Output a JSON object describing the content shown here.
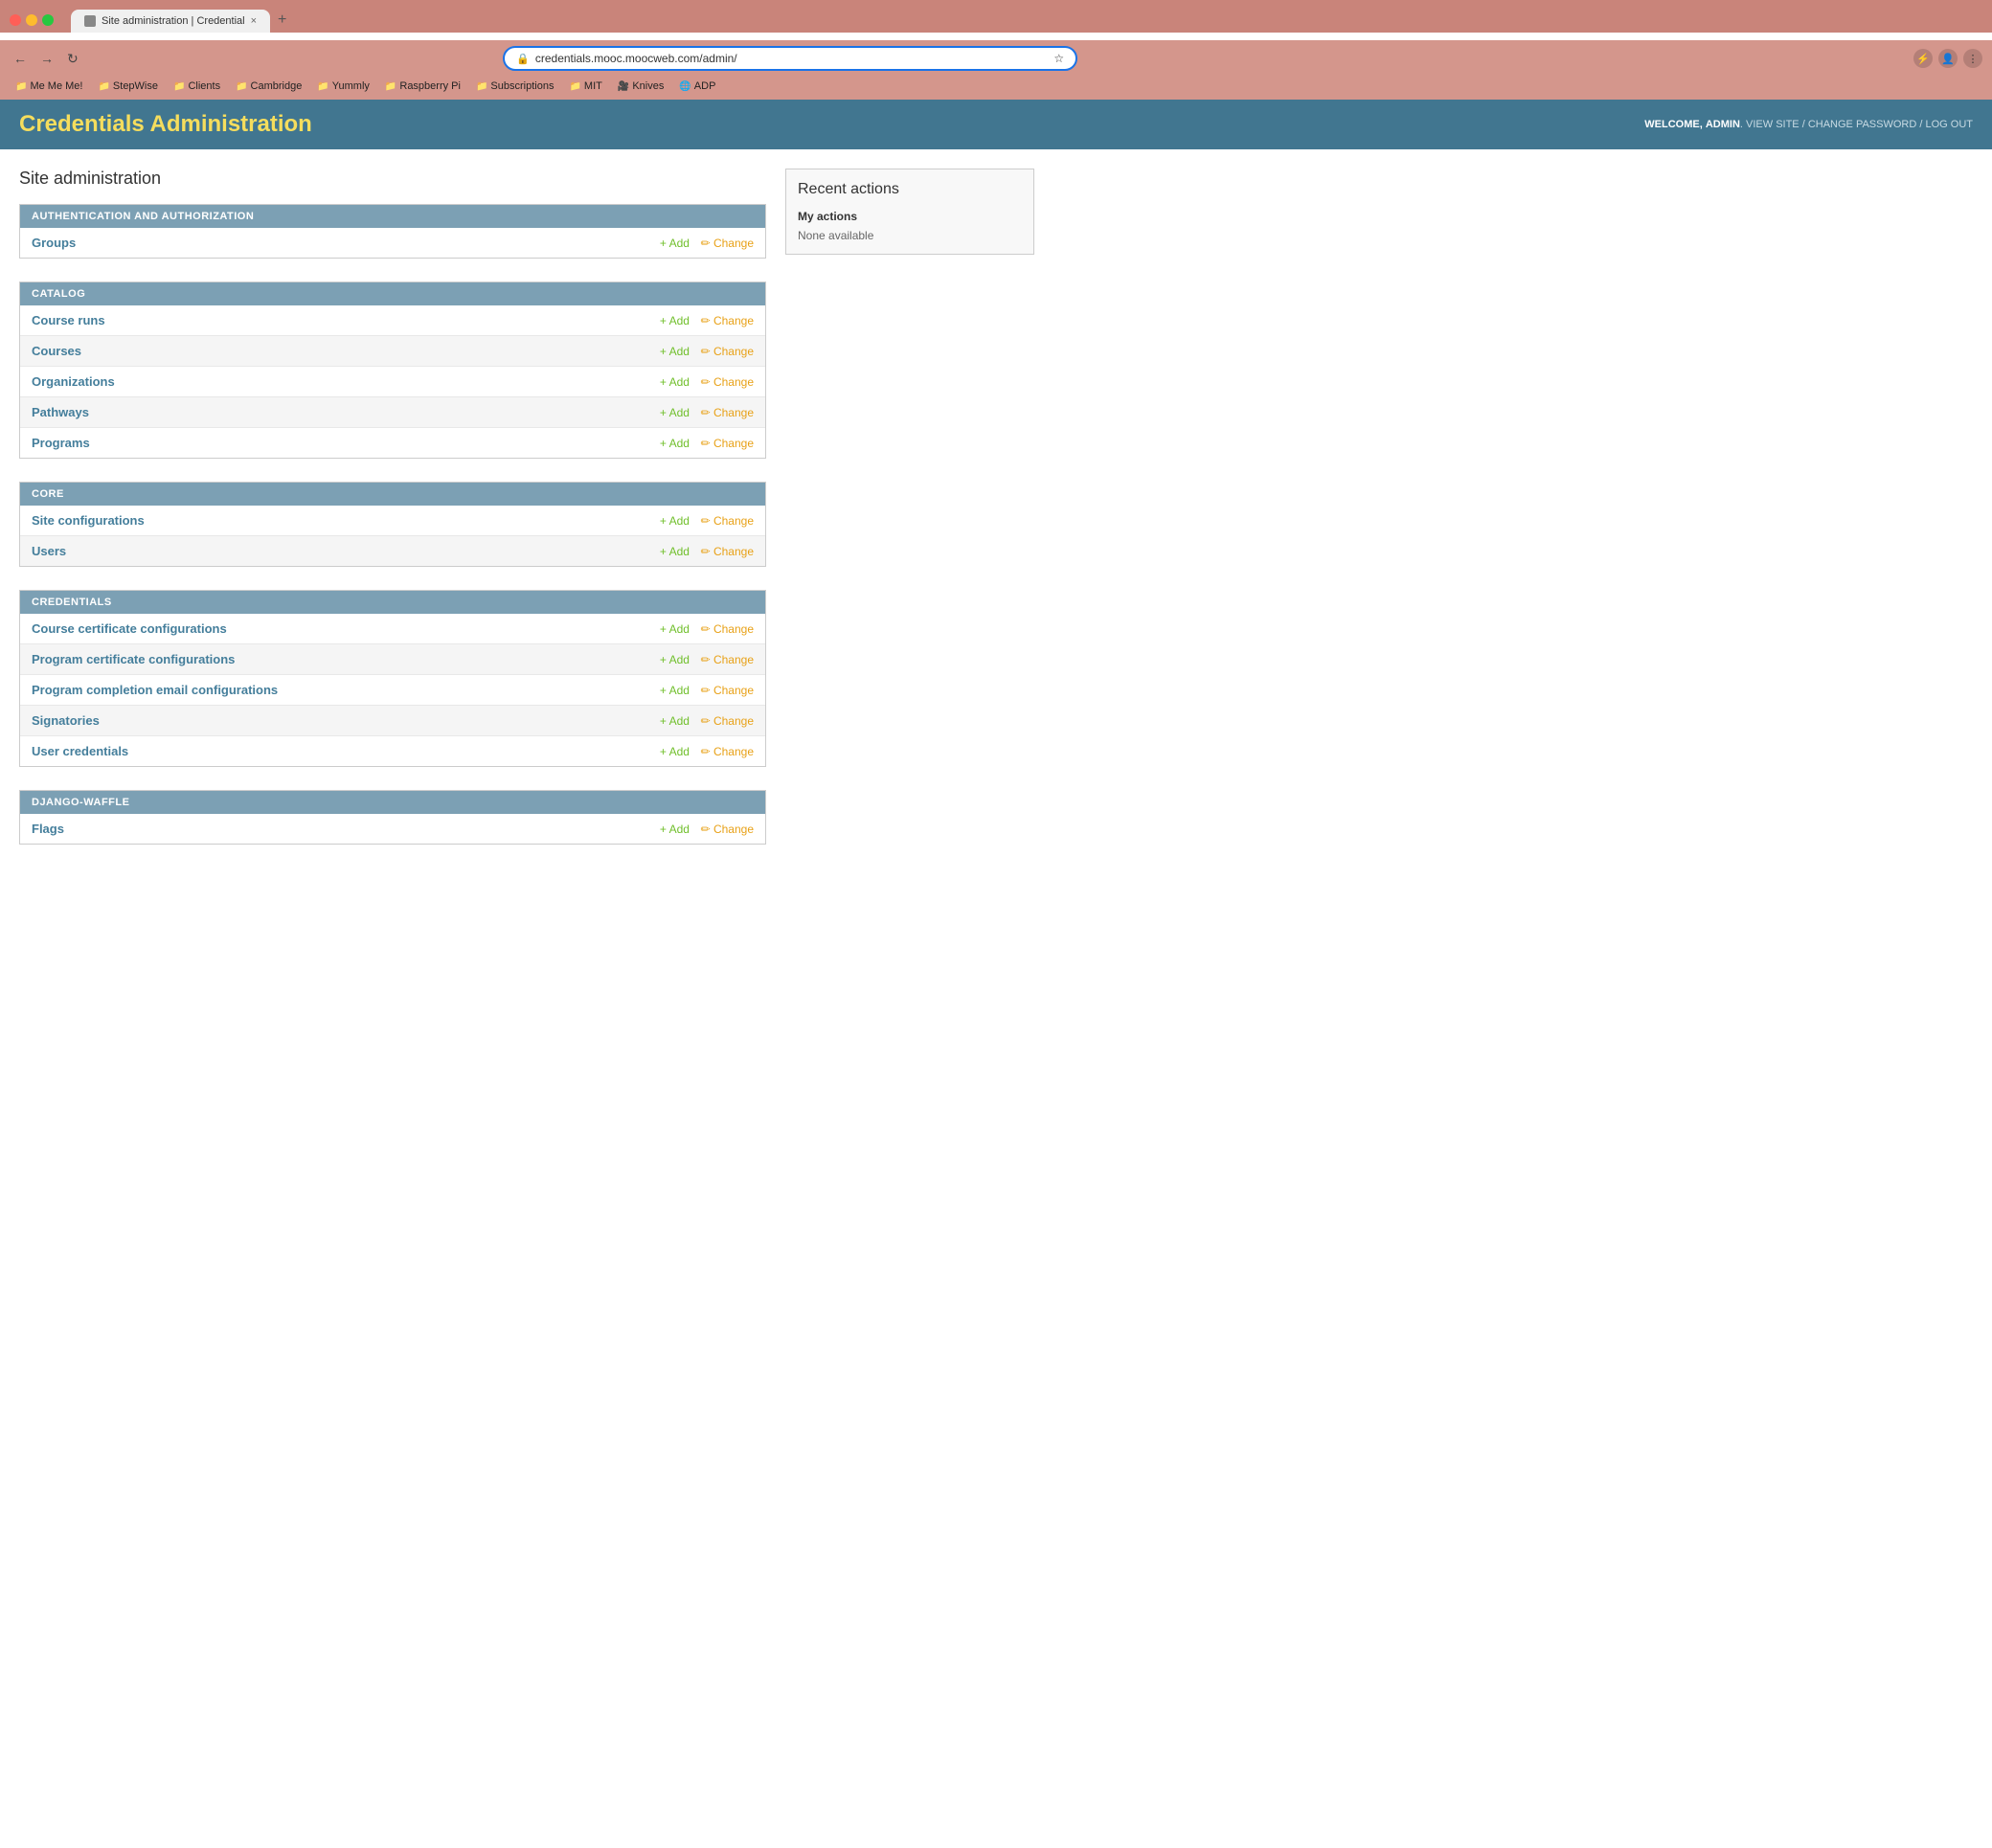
{
  "browser": {
    "tab_title": "Site administration | Credential",
    "tab_favicon": "🌐",
    "url": "credentials.mooc.moocweb.com/admin/",
    "new_tab_label": "+",
    "close_label": "×"
  },
  "bookmarks": [
    {
      "label": "Me Me Me!",
      "icon": "📁"
    },
    {
      "label": "StepWise",
      "icon": "📁"
    },
    {
      "label": "Clients",
      "icon": "📁"
    },
    {
      "label": "Cambridge",
      "icon": "📁"
    },
    {
      "label": "Yummly",
      "icon": "📁"
    },
    {
      "label": "Raspberry Pi",
      "icon": "📁"
    },
    {
      "label": "Subscriptions",
      "icon": "📁"
    },
    {
      "label": "MIT",
      "icon": "📁"
    },
    {
      "label": "Knives",
      "icon": "🎥"
    },
    {
      "label": "ADP",
      "icon": "🌐"
    }
  ],
  "header": {
    "title": "Credentials Administration",
    "welcome_prefix": "WELCOME,",
    "username": "ADMIN",
    "view_site_label": "VIEW SITE",
    "change_password_label": "CHANGE PASSWORD",
    "logout_label": "LOG OUT"
  },
  "page": {
    "title": "Site administration"
  },
  "sections": [
    {
      "id": "auth",
      "header": "AUTHENTICATION AND AUTHORIZATION",
      "models": [
        {
          "name": "Groups",
          "add_label": "+ Add",
          "change_label": "✏ Change"
        }
      ]
    },
    {
      "id": "catalog",
      "header": "CATALOG",
      "models": [
        {
          "name": "Course runs",
          "add_label": "+ Add",
          "change_label": "✏ Change"
        },
        {
          "name": "Courses",
          "add_label": "+ Add",
          "change_label": "✏ Change"
        },
        {
          "name": "Organizations",
          "add_label": "+ Add",
          "change_label": "✏ Change"
        },
        {
          "name": "Pathways",
          "add_label": "+ Add",
          "change_label": "✏ Change"
        },
        {
          "name": "Programs",
          "add_label": "+ Add",
          "change_label": "✏ Change"
        }
      ]
    },
    {
      "id": "core",
      "header": "CORE",
      "models": [
        {
          "name": "Site configurations",
          "add_label": "+ Add",
          "change_label": "✏ Change"
        },
        {
          "name": "Users",
          "add_label": "+ Add",
          "change_label": "✏ Change"
        }
      ]
    },
    {
      "id": "credentials",
      "header": "CREDENTIALS",
      "models": [
        {
          "name": "Course certificate configurations",
          "add_label": "+ Add",
          "change_label": "✏ Change"
        },
        {
          "name": "Program certificate configurations",
          "add_label": "+ Add",
          "change_label": "✏ Change"
        },
        {
          "name": "Program completion email configurations",
          "add_label": "+ Add",
          "change_label": "✏ Change"
        },
        {
          "name": "Signatories",
          "add_label": "+ Add",
          "change_label": "✏ Change"
        },
        {
          "name": "User credentials",
          "add_label": "+ Add",
          "change_label": "✏ Change"
        }
      ]
    },
    {
      "id": "django-waffle",
      "header": "DJANGO-WAFFLE",
      "models": [
        {
          "name": "Flags",
          "add_label": "+ Add",
          "change_label": "✏ Change"
        }
      ]
    }
  ],
  "sidebar": {
    "title": "Recent actions",
    "my_actions_label": "My actions",
    "none_available": "None available"
  }
}
